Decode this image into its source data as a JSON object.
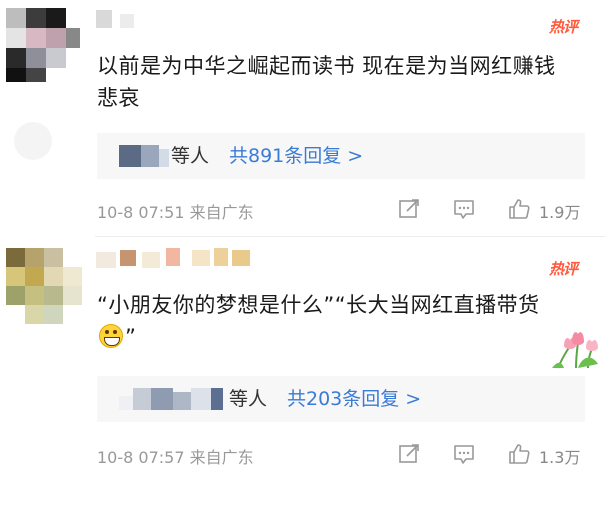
{
  "comments": [
    {
      "hot_label": "热评",
      "text": "以前是为中华之崛起而读书 现在是为当网红赚钱 悲哀",
      "reply": {
        "others_label": "等人",
        "count_label": "共891条回复 >"
      },
      "timestamp": "10-8 07:51 来自广东",
      "likes": "1.9万"
    },
    {
      "hot_label": "热评",
      "text_part1": "“小朋友你的梦想是什么”“长大当网红直播带货",
      "text_part2": "”",
      "reply": {
        "others_label": "等人",
        "count_label": "共203条回复 >"
      },
      "timestamp": "10-8 07:57 来自广东",
      "likes": "1.3万"
    }
  ],
  "icons": {
    "share": "share-icon",
    "comment": "comment-icon",
    "like": "thumbs-up-icon",
    "emoji": "grinning-face-emoji",
    "sticker": "tulip-flower-sticker"
  },
  "colors": {
    "hot": "#ff5a3d",
    "link": "#3a7bd5",
    "meta": "#999999",
    "reply_bg": "#f7f7f7"
  }
}
